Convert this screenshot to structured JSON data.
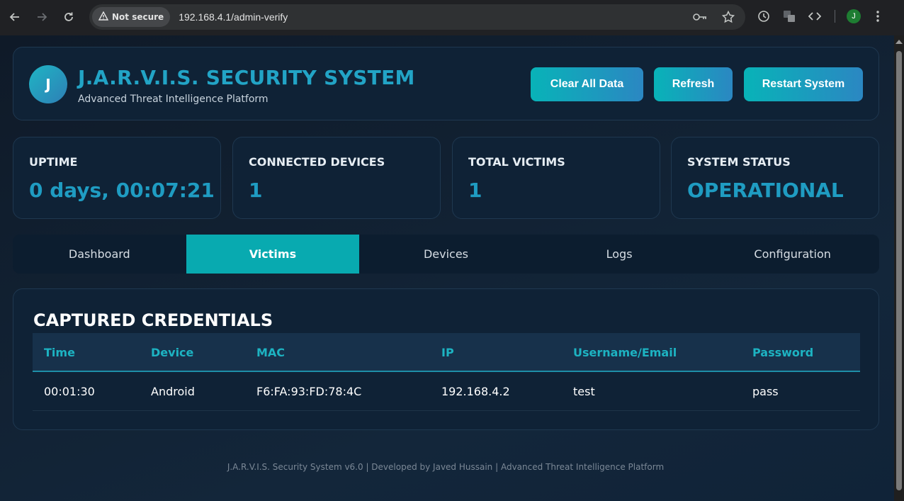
{
  "browser": {
    "security_label": "Not secure",
    "url": "192.168.4.1/admin-verify",
    "profile_initial": "J",
    "icons": [
      "back-icon",
      "forward-icon",
      "reload-icon",
      "warning-icon",
      "key-icon",
      "star-icon",
      "history-icon",
      "translate-icon",
      "devtools-icon",
      "menu-icon"
    ]
  },
  "header": {
    "logo_letter": "J",
    "title": "J.A.R.V.I.S. SECURITY SYSTEM",
    "subtitle": "Advanced Threat Intelligence Platform",
    "buttons": {
      "clear": "Clear All Data",
      "refresh": "Refresh",
      "restart": "Restart System"
    }
  },
  "stats": [
    {
      "label": "UPTIME",
      "value": "0 days, 00:07:21"
    },
    {
      "label": "CONNECTED DEVICES",
      "value": "1"
    },
    {
      "label": "TOTAL VICTIMS",
      "value": "1"
    },
    {
      "label": "SYSTEM STATUS",
      "value": "OPERATIONAL"
    }
  ],
  "tabs": [
    {
      "label": "Dashboard",
      "active": false
    },
    {
      "label": "Victims",
      "active": true
    },
    {
      "label": "Devices",
      "active": false
    },
    {
      "label": "Logs",
      "active": false
    },
    {
      "label": "Configuration",
      "active": false
    }
  ],
  "credentials": {
    "title": "CAPTURED CREDENTIALS",
    "columns": [
      "Time",
      "Device",
      "MAC",
      "IP",
      "Username/Email",
      "Password"
    ],
    "rows": [
      [
        "00:01:30",
        "Android",
        "F6:FA:93:FD:78:4C",
        "192.168.4.2",
        "test",
        "pass"
      ]
    ]
  },
  "footer": "J.A.R.V.I.S. Security System v6.0 | Developed by Javed Hussain | Advanced Threat Intelligence Platform",
  "colors": {
    "accent": "#08b3b8",
    "accent_blue": "#2b87c2",
    "value_text": "#1f9cc2",
    "background": "#0f1b29"
  }
}
